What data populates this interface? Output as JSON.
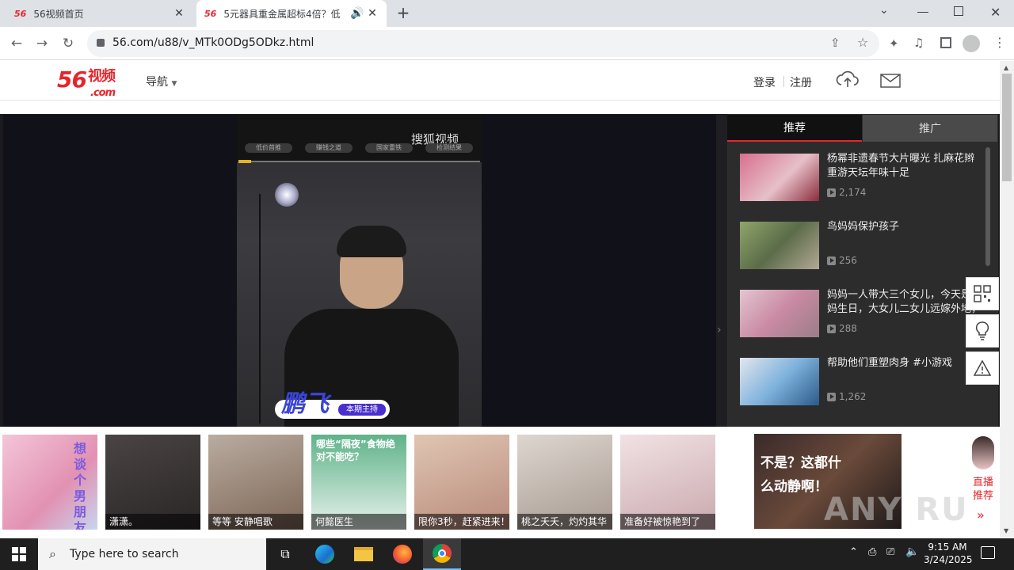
{
  "browser": {
    "tabs": [
      {
        "favicon": "56",
        "title": "56视频首页"
      },
      {
        "favicon": "56",
        "title": "5元器具重金属超标4倍？低"
      }
    ],
    "url": "56.com/u88/v_MTk0ODg5ODkz.html"
  },
  "site": {
    "logo_num": "56",
    "logo_cn": "视频",
    "logo_com": ".com",
    "nav_label": "导航",
    "login": "登录",
    "register": "注册"
  },
  "video": {
    "watermark": "搜狐视频",
    "chapters": [
      "低价首推",
      "赚钱之道",
      "国家重铁",
      "检测结果"
    ],
    "host_name": "鹏飞",
    "host_role": "本期主持"
  },
  "sidebar": {
    "tabs": [
      "推荐",
      "推广"
    ],
    "items": [
      {
        "title": "杨幂非遗春节大片曝光 扎麻花辫重游天坛年味十足",
        "views": "2,174",
        "thumb": "#c0587a"
      },
      {
        "title": "鸟妈妈保护孩子",
        "views": "256",
        "thumb": "#6f8a5a"
      },
      {
        "title": "妈妈一人带大三个女儿，今天是妈妈生日，大女儿二女儿远嫁外地，",
        "views": "288",
        "thumb": "#b98aa0"
      },
      {
        "title": "帮助他们重塑肉身 #小游戏",
        "views": "1,262",
        "thumb": "#6aa0c8"
      }
    ]
  },
  "strip": {
    "items": [
      {
        "caption": "",
        "art": "想谈个男朋友",
        "bg": "#e7a9c3"
      },
      {
        "caption": "潇潇。",
        "art": "",
        "bg": "#3b3838"
      },
      {
        "caption": "等等 安静唱歌",
        "art": "",
        "bg": "#8c7a6a"
      },
      {
        "caption": "何懿医生",
        "art": "哪些“隔夜”食物绝对不能吃？",
        "bg": "#4fa07a"
      },
      {
        "caption": "限你3秒，赶紧进来！",
        "art": "",
        "bg": "#d8b5a5"
      },
      {
        "caption": "桃之夭夭，灼灼其华",
        "art": "",
        "bg": "#cfc9c4"
      },
      {
        "caption": "准备好被惊艳到了",
        "art": "",
        "bg": "#e9d6d8"
      }
    ],
    "ad_text": "不是？这都什么动静啊！",
    "live_label": "直播推荐",
    "watermark": "ANY RUN"
  },
  "taskbar": {
    "search_placeholder": "Type here to search",
    "time": "9:15 AM",
    "date": "3/24/2025"
  }
}
